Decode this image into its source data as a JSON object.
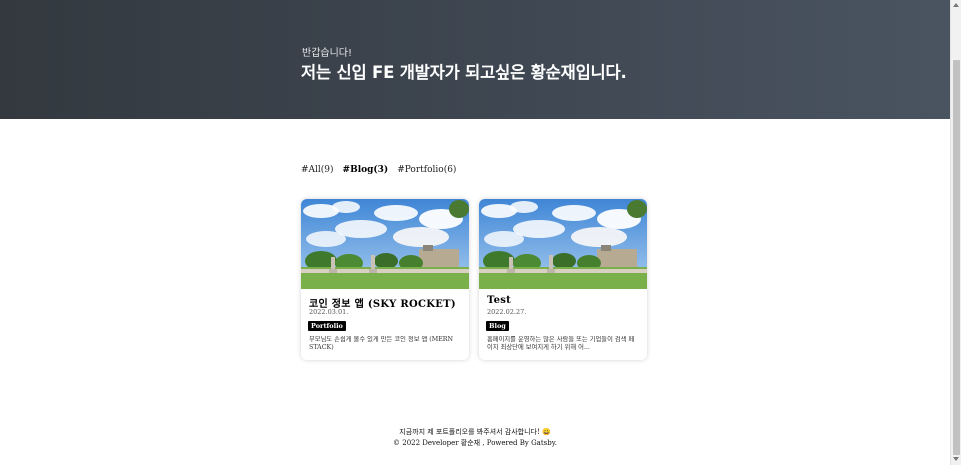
{
  "hero": {
    "greeting": "반갑습니다!",
    "headline": "저는 신입 FE 개발자가 되고싶은 황순재입니다."
  },
  "filters": {
    "all": "#All(9)",
    "blog": "#Blog(3)",
    "portfolio": "#Portfolio(6)",
    "active": "blog"
  },
  "posts": [
    {
      "title": "코인 정보 앱 (SKY ROCKET)",
      "date": "2022.03.01.",
      "category": "Portfolio",
      "summary": "부모님도 손쉽게 볼수 있게 만든 코인 정보 앱 (MERN STACK)"
    },
    {
      "title": "Test",
      "date": "2022.02.27.",
      "category": "Blog",
      "summary": "홈페이지를 운영하는 많은 사람들 또는 기업들이 검색 페이지 최상단에 보여지게 하기 위해 어..."
    }
  ],
  "footer": {
    "thanks": "지금까지 제 포트폴리오를 봐주셔서 감사합니다! 😀",
    "copyright": "© 2022 Developer 황순재 , Powered By Gatsby."
  },
  "colors": {
    "hero_start": "#33393f",
    "hero_end": "#4a5461",
    "badge": "#000000"
  }
}
